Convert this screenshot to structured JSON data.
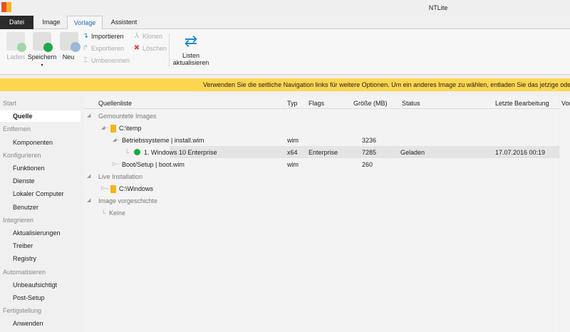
{
  "app": {
    "title": "NTLite"
  },
  "tabs": [
    {
      "label": "Datei"
    },
    {
      "label": "Image"
    },
    {
      "label": "Vorlage"
    },
    {
      "label": "Assistent"
    }
  ],
  "ribbon": {
    "laden": "Laden",
    "speichern": "Speichern",
    "neu": "Neu",
    "importieren": "Importieren",
    "exportieren": "Exportieren",
    "umbenennen": "Umbenennen",
    "klonen": "Klonen",
    "loeschen": "Löschen",
    "listen_line1": "Listen",
    "listen_line2": "aktualisieren"
  },
  "notice": "Verwenden Sie die seitliche Navigation links für weitere Optionen. Um ein anderes Image zu wählen, entladen Sie das jetzige oder w",
  "sidebar": [
    {
      "label": "Start",
      "type": "h"
    },
    {
      "label": "Quelle",
      "type": "sel"
    },
    {
      "label": "Entfernen",
      "type": "h"
    },
    {
      "label": "Komponenten",
      "type": "i"
    },
    {
      "label": "Konfigurieren",
      "type": "h"
    },
    {
      "label": "Funktionen",
      "type": "i"
    },
    {
      "label": "Dienste",
      "type": "i"
    },
    {
      "label": "Lokaler Computer",
      "type": "i"
    },
    {
      "label": "Benutzer",
      "type": "i"
    },
    {
      "label": "Integrieren",
      "type": "h"
    },
    {
      "label": "Aktualisierungen",
      "type": "i"
    },
    {
      "label": "Treiber",
      "type": "i"
    },
    {
      "label": "Registry",
      "type": "i"
    },
    {
      "label": "Automatisieren",
      "type": "h"
    },
    {
      "label": "Unbeaufsichtigt",
      "type": "i"
    },
    {
      "label": "Post-Setup",
      "type": "i"
    },
    {
      "label": "Fertigstellung",
      "type": "h"
    },
    {
      "label": "Anwenden",
      "type": "i"
    }
  ],
  "columns": {
    "name": "Quellenliste",
    "typ": "Typ",
    "flags": "Flags",
    "size": "Größe (MB)",
    "status": "Status",
    "date": "Letzte Bearbeitung"
  },
  "right_pane": {
    "label": "Vorl"
  },
  "tree": {
    "mounted": "Gemountete Images",
    "temp": "C:\\temp",
    "install": {
      "name": "Betriebssysteme  |  install.wim",
      "typ": "wim",
      "size": "3236"
    },
    "win10": {
      "name": "1. Windows 10 Enterprise",
      "typ": "x64",
      "flags": "Enterprise",
      "size": "7285",
      "status": "Geladen",
      "date": "17.07.2016 00:19"
    },
    "boot": {
      "name": "Boot/Setup  |  boot.wim",
      "typ": "wim",
      "size": "260"
    },
    "live": "Live Installation",
    "windows": "C:\\Windows",
    "history": "Image vorgeschichte",
    "none": "Keine"
  }
}
